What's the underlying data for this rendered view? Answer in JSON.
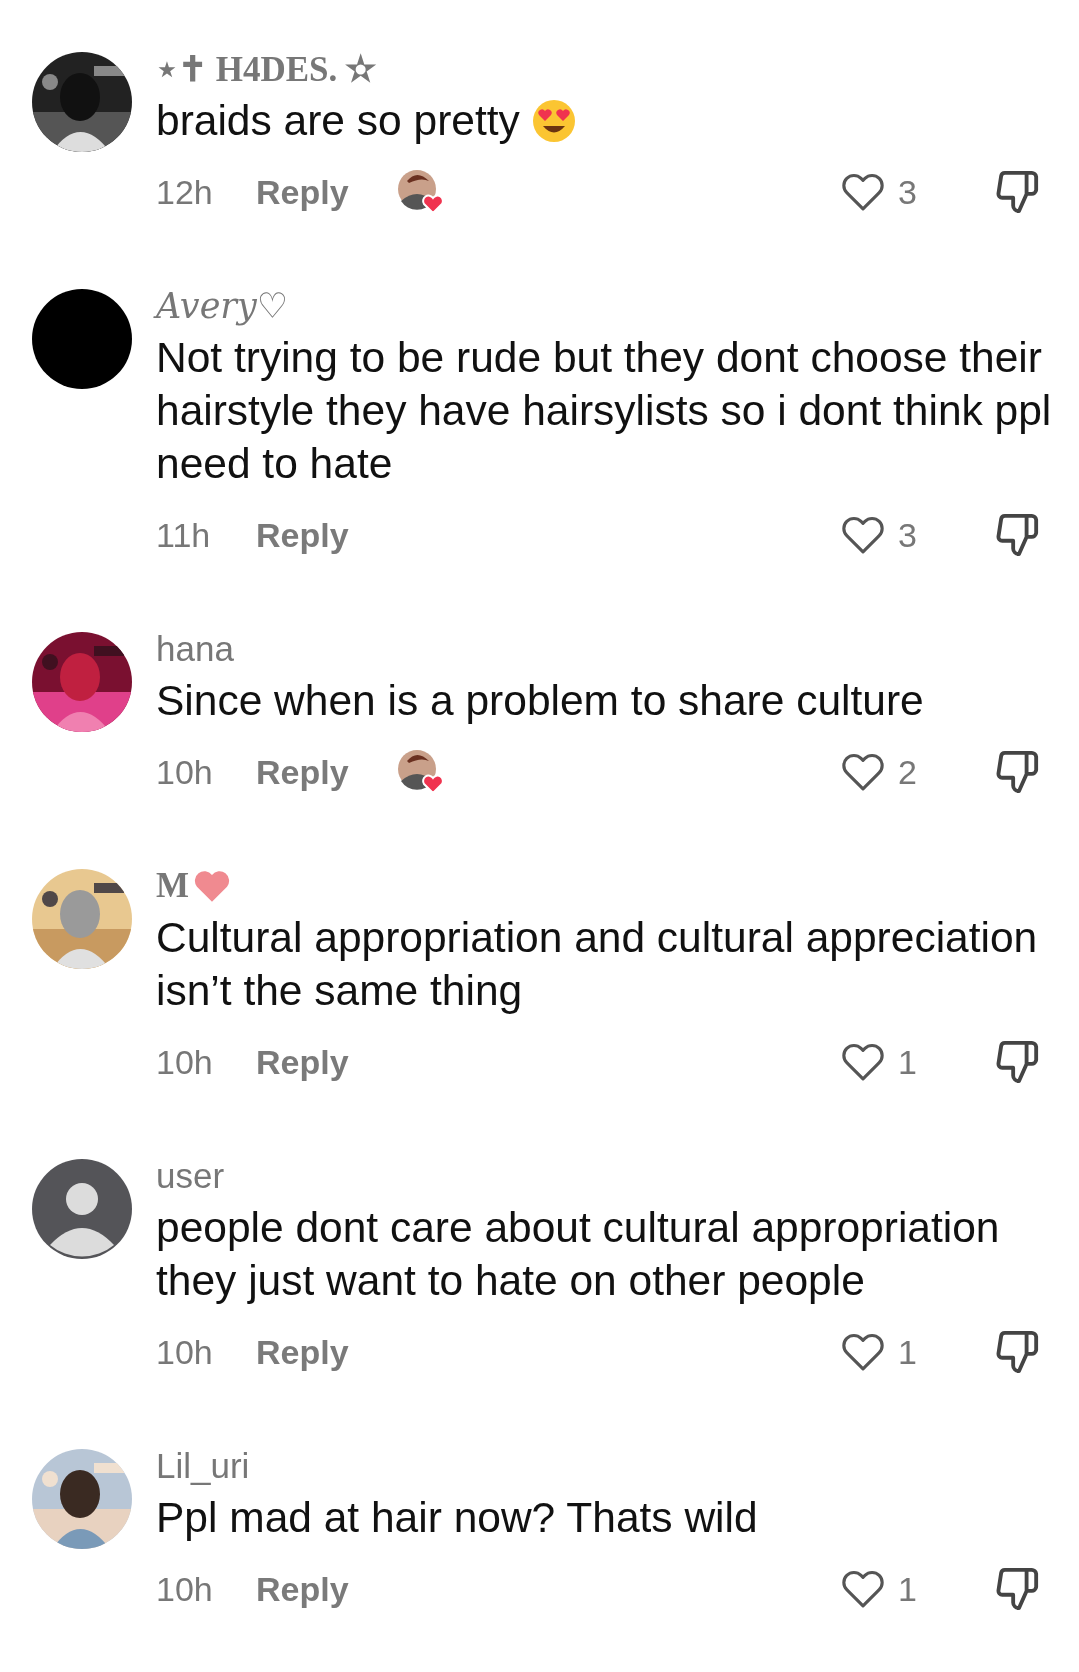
{
  "comments": [
    {
      "author": {
        "name": "⋆✝ H4DES. ✫",
        "kind": "serif"
      },
      "name_heart": false,
      "text": "braids are so pretty",
      "emoji_heart_eyes": true,
      "time": "12h",
      "reply": "Reply",
      "liked_by_creator": true,
      "likes": "3"
    },
    {
      "author": {
        "name": "Avery♡",
        "kind": "script"
      },
      "name_heart": false,
      "avatar": {
        "kind": "solid"
      },
      "text": "Not trying to be rude but they dont choose their hairstyle they have hairsylists so i dont think ppl need to hate",
      "emoji_heart_eyes": false,
      "time": "11h",
      "reply": "Reply",
      "liked_by_creator": false,
      "likes": "3"
    },
    {
      "author": {
        "name": "hana",
        "kind": "plain"
      },
      "name_heart": false,
      "text": "Since when is a problem to share culture",
      "emoji_heart_eyes": false,
      "time": "10h",
      "reply": "Reply",
      "liked_by_creator": true,
      "likes": "2"
    },
    {
      "author": {
        "name": "M",
        "kind": "fraktur"
      },
      "name_heart": true,
      "text": "Cultural appropriation and cultural appreciation isn’t the same thing",
      "emoji_heart_eyes": false,
      "time": "10h",
      "reply": "Reply",
      "liked_by_creator": false,
      "likes": "1"
    },
    {
      "author": {
        "name": "user",
        "kind": "plain"
      },
      "name_heart": false,
      "avatar": {
        "kind": "default"
      },
      "text": "people dont care about cultural appropriation they just want to hate on other people",
      "emoji_heart_eyes": false,
      "time": "10h",
      "reply": "Reply",
      "liked_by_creator": false,
      "likes": "1"
    },
    {
      "author": {
        "name": "Lil_uri",
        "kind": "plain"
      },
      "name_heart": false,
      "text": "Ppl mad at hair now? Thats wild",
      "emoji_heart_eyes": false,
      "time": "10h",
      "reply": "Reply",
      "liked_by_creator": false,
      "likes": "1"
    }
  ]
}
